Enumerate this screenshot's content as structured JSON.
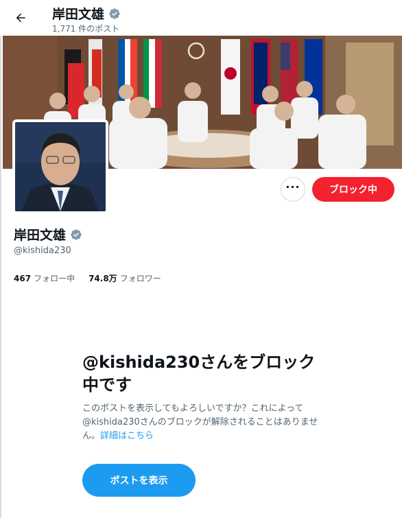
{
  "header": {
    "name": "岸田文雄",
    "post_count": "1,771 件のポスト"
  },
  "profile": {
    "name": "岸田文雄",
    "handle": "@kishida230",
    "following_count": "467",
    "following_label": "フォロー中",
    "followers_count": "74.8万",
    "followers_label": "フォロワー",
    "verified_icon": "verified-badge-icon",
    "verified_color": "#829aab"
  },
  "actions": {
    "more_label": "···",
    "block_label": "ブロック中",
    "block_color": "#f4212e"
  },
  "blocked": {
    "title": "@kishida230さんをブロック中です",
    "description": "このポストを表示してもよろしいですか？これによって@kishida230さんのブロックが解除されることはありません。",
    "link_text": "詳細はこちら",
    "button_label": "ポストを表示",
    "accent_color": "#1d9bf0"
  }
}
